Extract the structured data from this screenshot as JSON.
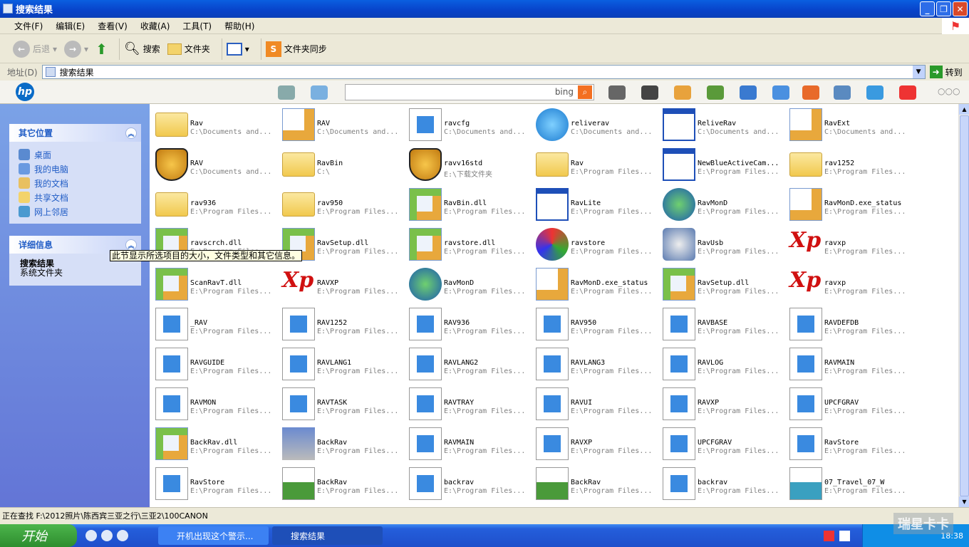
{
  "window": {
    "title": "搜索结果"
  },
  "menu": [
    "文件(F)",
    "编辑(E)",
    "查看(V)",
    "收藏(A)",
    "工具(T)",
    "帮助(H)"
  ],
  "toolbar": {
    "back": "后退",
    "search": "搜索",
    "folders": "文件夹",
    "sync": "文件夹同步"
  },
  "address": {
    "label": "地址(D)",
    "value": "搜索结果",
    "go": "转到"
  },
  "hpbar": {
    "logo": "hp",
    "search_brand": "bing",
    "search_value": ""
  },
  "sidebar": {
    "other_places": {
      "title": "其它位置",
      "items": [
        "桌面",
        "我的电脑",
        "我的文档",
        "共享文档",
        "网上邻居"
      ]
    },
    "details": {
      "title": "详细信息",
      "name": "搜索结果",
      "type": "系统文件夹"
    }
  },
  "tooltip": "此节显示所选项目的大小，文件类型和其它信息。",
  "items": [
    {
      "name": "Rav",
      "path": "C:\\Documents and...",
      "icon": "folder"
    },
    {
      "name": "RAV",
      "path": "C:\\Documents and...",
      "icon": "config"
    },
    {
      "name": "ravcfg",
      "path": "C:\\Documents and...",
      "icon": "ie"
    },
    {
      "name": "reliverav",
      "path": "C:\\Documents and...",
      "icon": "ball"
    },
    {
      "name": "ReliveRav",
      "path": "C:\\Documents and...",
      "icon": "window"
    },
    {
      "name": "RavExt",
      "path": "C:\\Documents and...",
      "icon": "config"
    },
    {
      "name": "RAV",
      "path": "C:\\Documents and...",
      "icon": "lion"
    },
    {
      "name": "RavBin",
      "path": "C:\\",
      "icon": "folder"
    },
    {
      "name": "ravv16std",
      "path": "E:\\下载文件夹",
      "icon": "lion"
    },
    {
      "name": "Rav",
      "path": "E:\\Program Files...",
      "icon": "folder"
    },
    {
      "name": "NewBlueActiveCam...",
      "path": "E:\\Program Files...",
      "icon": "window"
    },
    {
      "name": "rav1252",
      "path": "E:\\Program Files...",
      "icon": "folder"
    },
    {
      "name": "rav936",
      "path": "E:\\Program Files...",
      "icon": "folder"
    },
    {
      "name": "rav950",
      "path": "E:\\Program Files...",
      "icon": "folder"
    },
    {
      "name": "RavBin.dll",
      "path": "E:\\Program Files...",
      "icon": "dll"
    },
    {
      "name": "RavLite",
      "path": "E:\\Program Files...",
      "icon": "window"
    },
    {
      "name": "RavMonD",
      "path": "E:\\Program Files...",
      "icon": "globe"
    },
    {
      "name": "RavMonD.exe_status",
      "path": "E:\\Program Files...",
      "icon": "config"
    },
    {
      "name": "ravscrch.dll",
      "path": "E:\\Program Files...",
      "icon": "dll"
    },
    {
      "name": "RavSetup.dll",
      "path": "E:\\Program Files...",
      "icon": "dll"
    },
    {
      "name": "ravstore.dll",
      "path": "E:\\Program Files...",
      "icon": "dll"
    },
    {
      "name": "ravstore",
      "path": "E:\\Program Files...",
      "icon": "recycle"
    },
    {
      "name": "RavUsb",
      "path": "E:\\Program Files...",
      "icon": "gear"
    },
    {
      "name": "ravxp",
      "path": "E:\\Program Files...",
      "icon": "xp"
    },
    {
      "name": "ScanRavT.dll",
      "path": "E:\\Program Files...",
      "icon": "dll"
    },
    {
      "name": "RAVXP",
      "path": "E:\\Program Files...",
      "icon": "xp"
    },
    {
      "name": "RavMonD",
      "path": "E:\\Program Files...",
      "icon": "globe"
    },
    {
      "name": "RavMonD.exe_status",
      "path": "E:\\Program Files...",
      "icon": "config"
    },
    {
      "name": "RavSetup.dll",
      "path": "E:\\Program Files...",
      "icon": "dll"
    },
    {
      "name": "ravxp",
      "path": "E:\\Program Files...",
      "icon": "xp"
    },
    {
      "name": "_RAV",
      "path": "E:\\Program Files...",
      "icon": "ie"
    },
    {
      "name": "RAV1252",
      "path": "E:\\Program Files...",
      "icon": "ie"
    },
    {
      "name": "RAV936",
      "path": "E:\\Program Files...",
      "icon": "ie"
    },
    {
      "name": "RAV950",
      "path": "E:\\Program Files...",
      "icon": "ie"
    },
    {
      "name": "RAVBASE",
      "path": "E:\\Program Files...",
      "icon": "ie"
    },
    {
      "name": "RAVDEFDB",
      "path": "E:\\Program Files...",
      "icon": "ie"
    },
    {
      "name": "RAVGUIDE",
      "path": "E:\\Program Files...",
      "icon": "ie"
    },
    {
      "name": "RAVLANG1",
      "path": "E:\\Program Files...",
      "icon": "ie"
    },
    {
      "name": "RAVLANG2",
      "path": "E:\\Program Files...",
      "icon": "ie"
    },
    {
      "name": "RAVLANG3",
      "path": "E:\\Program Files...",
      "icon": "ie"
    },
    {
      "name": "RAVLOG",
      "path": "E:\\Program Files...",
      "icon": "ie"
    },
    {
      "name": "RAVMAIN",
      "path": "E:\\Program Files...",
      "icon": "ie"
    },
    {
      "name": "RAVMON",
      "path": "E:\\Program Files...",
      "icon": "ie"
    },
    {
      "name": "RAVTASK",
      "path": "E:\\Program Files...",
      "icon": "ie"
    },
    {
      "name": "RAVTRAY",
      "path": "E:\\Program Files...",
      "icon": "ie"
    },
    {
      "name": "RAVUI",
      "path": "E:\\Program Files...",
      "icon": "ie"
    },
    {
      "name": "RAVXP",
      "path": "E:\\Program Files...",
      "icon": "ie"
    },
    {
      "name": "UPCFGRAV",
      "path": "E:\\Program Files...",
      "icon": "ie"
    },
    {
      "name": "BackRav.dll",
      "path": "E:\\Program Files...",
      "icon": "dll"
    },
    {
      "name": "BackRav",
      "path": "E:\\Program Files...",
      "icon": "setup"
    },
    {
      "name": "RAVMAIN",
      "path": "E:\\Program Files...",
      "icon": "ie"
    },
    {
      "name": "RAVXP",
      "path": "E:\\Program Files...",
      "icon": "ie"
    },
    {
      "name": "UPCFGRAV",
      "path": "E:\\Program Files...",
      "icon": "ie"
    },
    {
      "name": "RavStore",
      "path": "E:\\Program Files...",
      "icon": "ie"
    },
    {
      "name": "RavStore",
      "path": "E:\\Program Files...",
      "icon": "ie"
    },
    {
      "name": "BackRav",
      "path": "E:\\Program Files...",
      "icon": "png"
    },
    {
      "name": "backrav",
      "path": "E:\\Program Files...",
      "icon": "ie"
    },
    {
      "name": "BackRav",
      "path": "E:\\Program Files...",
      "icon": "png"
    },
    {
      "name": "backrav",
      "path": "E:\\Program Files...",
      "icon": "ie"
    },
    {
      "name": "07_Travel_07_W",
      "path": "E:\\Program Files...",
      "icon": "swf"
    }
  ],
  "status": "正在查找 F:\\2012照片\\陈西宾三亚之行\\三亚2\\100CANON",
  "taskbar": {
    "start": "开始",
    "tasks": [
      "开机出现这个警示...",
      "搜索结果"
    ],
    "clock": "18:38"
  },
  "watermark": "瑞星卡卡"
}
